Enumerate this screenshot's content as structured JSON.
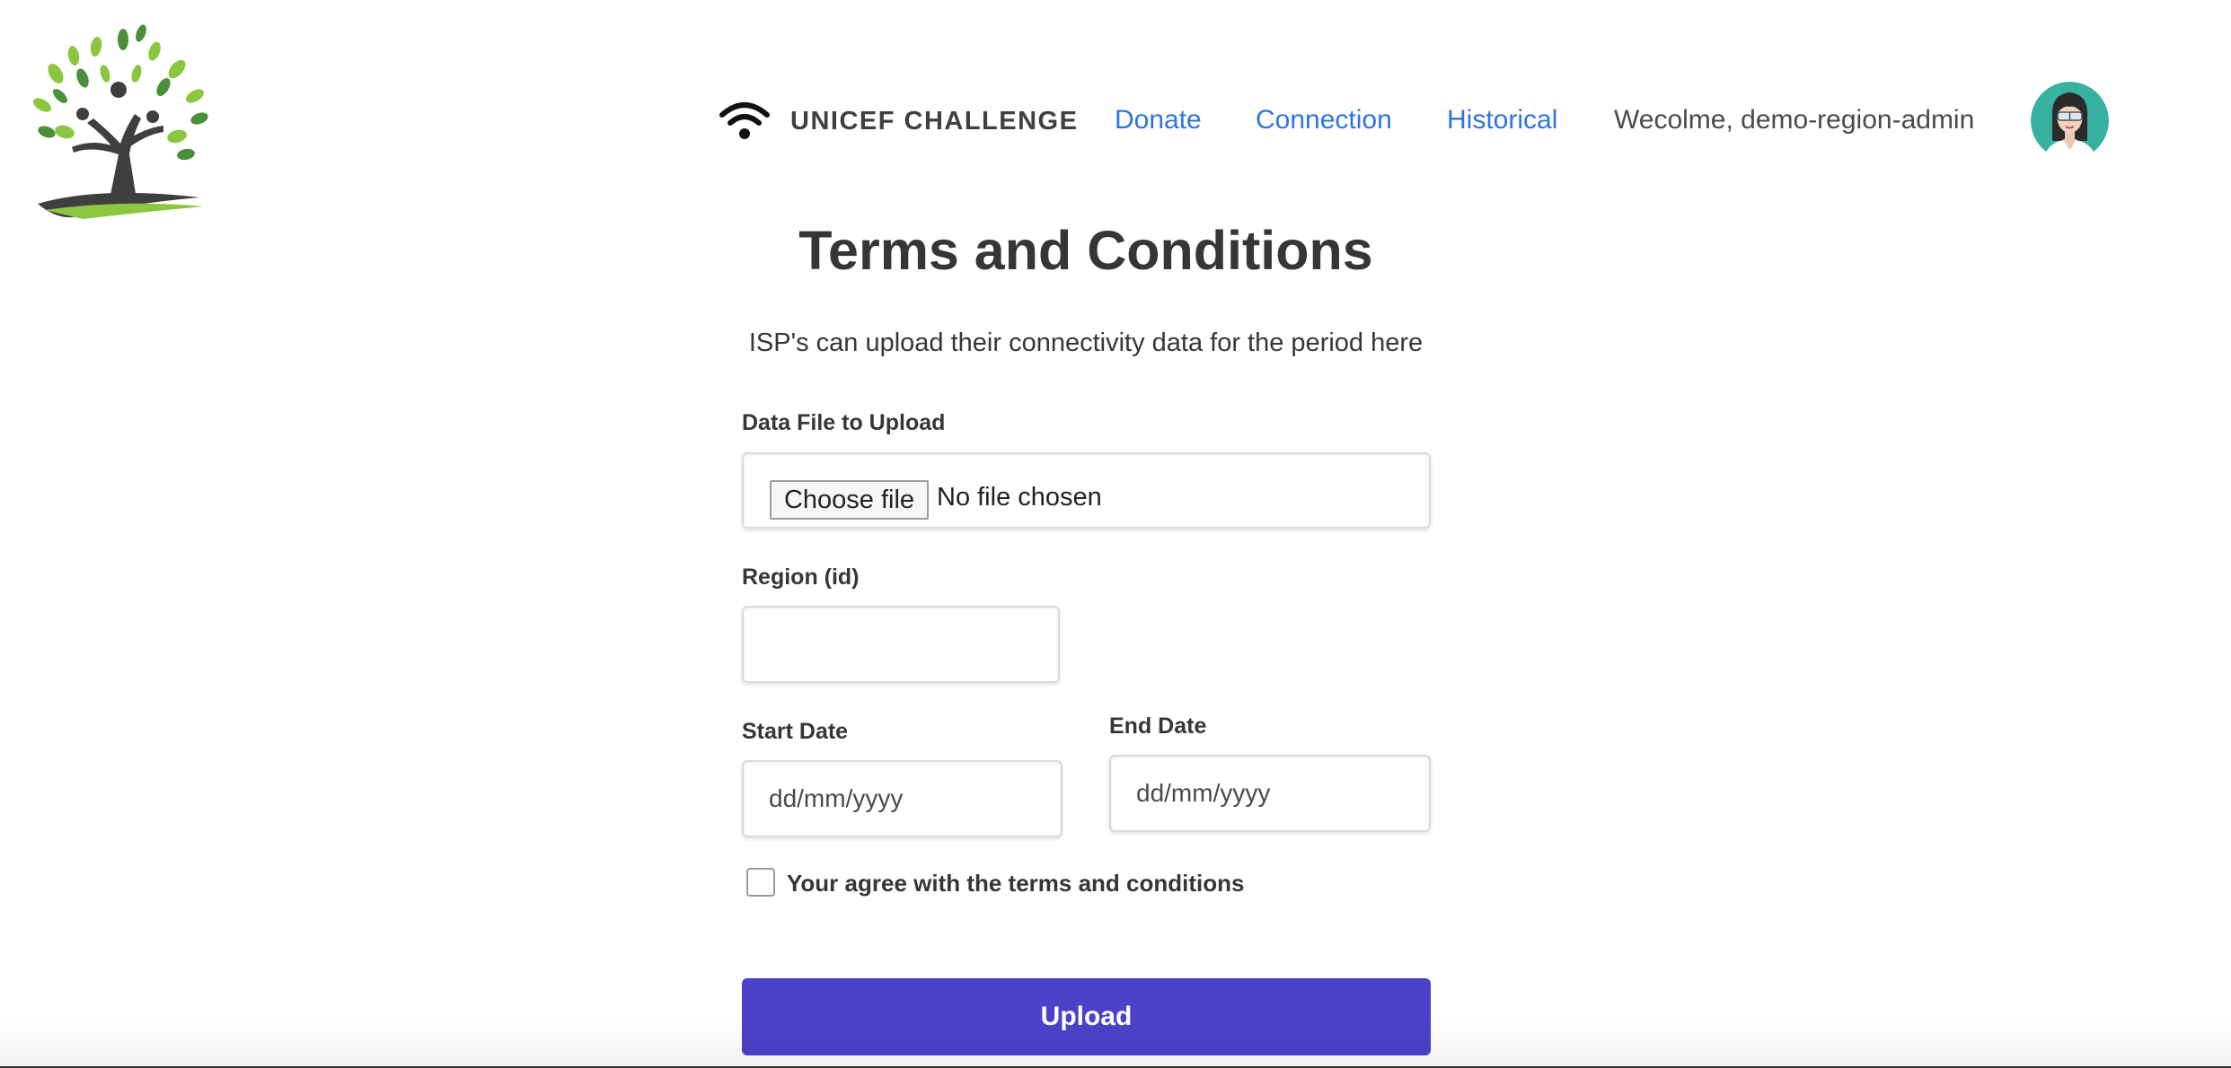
{
  "navbar": {
    "brand_text": "UNICEF CHALLENGE",
    "brand_icon": "wifi-icon",
    "links": [
      "Donate",
      "Connection",
      "Historical"
    ],
    "welcome": "Wecolme, demo-region-admin",
    "link_color": "#3273dc"
  },
  "main": {
    "title": "Terms and Conditions",
    "subtitle": "ISP's can upload their connectivity data for the period here",
    "file_label": "Data File to Upload",
    "choose_file": "Choose file",
    "no_file": "No file chosen",
    "region_label": "Region (id)",
    "region_value": "",
    "start_label": "Start Date",
    "start_placeholder": "dd/mm/yyyy",
    "end_label": "End Date",
    "end_placeholder": "dd/mm/yyyy",
    "agree_label": "Your agree with the terms and conditions",
    "agree_checked": false,
    "upload_label": "Upload",
    "upload_color": "#4c41c9"
  }
}
